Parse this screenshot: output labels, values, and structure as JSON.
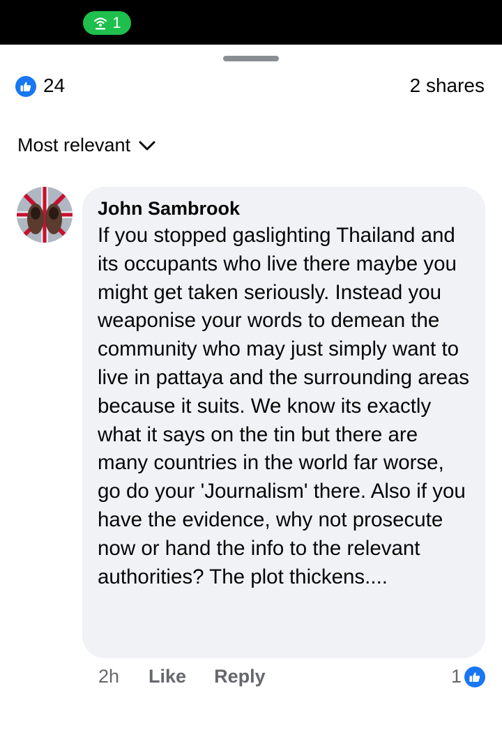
{
  "status_bar": {
    "hotspot_count": "1",
    "hotspot_color": "#1fbf4d"
  },
  "post": {
    "reactions_count": "24",
    "shares": "2 shares",
    "like_color": "#1877f2"
  },
  "sort": {
    "label": "Most relevant"
  },
  "comment": {
    "author": "John Sambrook",
    "text": "If you stopped gaslighting Thailand and its occupants who live there maybe you might get taken seriously. Instead you weaponise your words to demean the community who may just simply want to live in pattaya and the surrounding areas because it suits. We know its exactly what it says on the tin but there are many countries in the world far worse, go do your 'Journalism' there. Also if you have the evidence, why not prosecute now or hand the info to the relevant authorities? The plot thickens....",
    "time": "2h",
    "like_label": "Like",
    "reply_label": "Reply",
    "reaction_count": "1"
  }
}
